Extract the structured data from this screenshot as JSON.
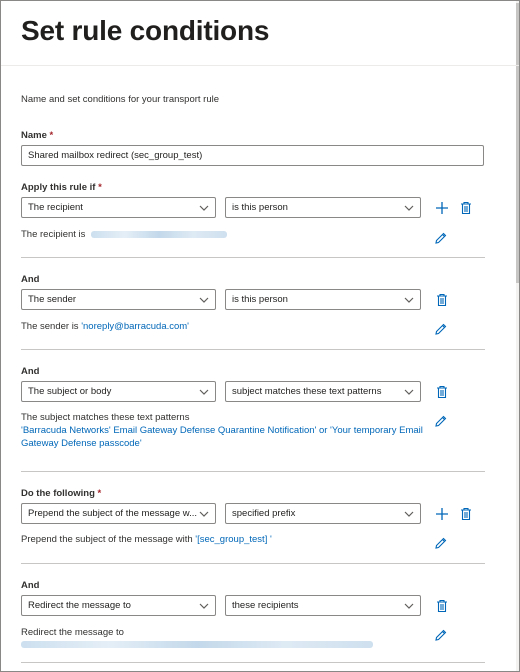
{
  "page": {
    "title": "Set rule conditions",
    "description": "Name and set conditions for your transport rule"
  },
  "name_field": {
    "label": "Name",
    "required_mark": "*",
    "value": "Shared mailbox redirect (sec_group_test)"
  },
  "sections": [
    {
      "heading": "Apply this rule if",
      "required_mark": "*",
      "condition": "The recipient",
      "operator": "is this person",
      "summary_prefix": "The recipient is",
      "summary_link": ""
    },
    {
      "heading": "And",
      "condition": "The sender",
      "operator": "is this person",
      "summary_prefix": "The sender is",
      "summary_link": "'noreply@barracuda.com'"
    },
    {
      "heading": "And",
      "condition": "The subject or body",
      "operator": "subject matches these text patterns",
      "summary_prefix": "The subject matches these text patterns",
      "summary_link_line1": "'Barracuda Networks' Email Gateway Defense Quarantine Notification' or 'Your temporary Email",
      "summary_link_line2": "Gateway Defense passcode'"
    },
    {
      "heading": "Do the following",
      "required_mark": "*",
      "condition": "Prepend the subject of the message w...",
      "operator": "specified prefix",
      "summary_prefix": "Prepend the subject of the message with",
      "summary_link": "'[sec_group_test] '"
    },
    {
      "heading": "And",
      "condition": "Redirect the message to",
      "operator": "these recipients",
      "summary_prefix": "Redirect the message to",
      "summary_link": ""
    }
  ],
  "icons": {
    "add": "plus-icon",
    "delete": "trash-icon",
    "edit": "pencil-icon",
    "dropdown": "chevron-down-icon"
  },
  "colors": {
    "accent": "#0067b8",
    "required": "#a4262c",
    "border": "#8a8886",
    "text": "#201f1e"
  }
}
